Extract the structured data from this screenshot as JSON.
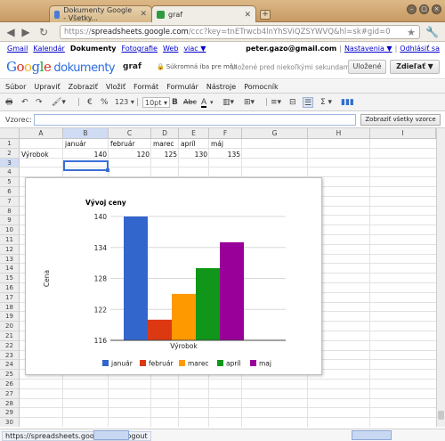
{
  "browser": {
    "tabs": [
      {
        "title": "Dokumenty Google - Všetky..."
      },
      {
        "title": "graf"
      }
    ],
    "new_tab": "+",
    "url": {
      "scheme": "https://",
      "domain": "spreadsheets.google.com",
      "path": "/ccc?key=tnETrwcb4lnYhSViQZSYWVQ&hl=sk#gid=0"
    }
  },
  "gbar": {
    "left": [
      "Gmail",
      "Kalendár",
      "Dokumenty",
      "Fotografie",
      "Web",
      "viac ▼"
    ],
    "current": "Dokumenty",
    "email": "peter.gazo@gmail.com",
    "settings": "Nastavenia ▼",
    "logout": "Odhlásiť sa"
  },
  "titlebar": {
    "logo_letters": [
      "G",
      "o",
      "o",
      "g",
      "l",
      "e"
    ],
    "logo_suffix": "dokumenty",
    "doc_name": "graf",
    "privacy": "Súkromná iba pre mňa",
    "save_status": "Uložené pred niekoľkými sekundami",
    "save_button": "Uložené",
    "share_button": "Zdieľať ▼"
  },
  "menu": [
    "Súbor",
    "Upraviť",
    "Zobraziť",
    "Vložiť",
    "Formát",
    "Formulár",
    "Nástroje",
    "Pomocník"
  ],
  "format_toolbar": {
    "currency": "€",
    "percent": "%",
    "number_format": "123 ▾",
    "font_size": "10pt ▾",
    "bold": "B",
    "strike": "Abc",
    "text_color": "A",
    "sum": "Σ ▾"
  },
  "formula_bar": {
    "label": "Vzorec:",
    "value": "",
    "show_all_button": "Zobraziť všetky vzorce"
  },
  "sheet": {
    "columns": [
      "A",
      "B",
      "C",
      "D",
      "E",
      "F",
      "G",
      "H",
      "I"
    ],
    "selected_column": "B",
    "rows": [
      "1",
      "2",
      "3",
      "4",
      "5",
      "6",
      "7",
      "8",
      "9",
      "10",
      "11",
      "12",
      "13",
      "14",
      "15",
      "16",
      "17",
      "18",
      "19",
      "20",
      "21",
      "22",
      "23",
      "24",
      "25",
      "26",
      "27",
      "28",
      "29",
      "30"
    ],
    "selected_row": "3",
    "row1": {
      "B": "január",
      "C": "február",
      "D": "marec",
      "E": "apríl",
      "F": "máj"
    },
    "row2": {
      "A": "Výrobok",
      "B": "140",
      "C": "120",
      "D": "125",
      "E": "130",
      "F": "135"
    }
  },
  "chart_data": {
    "type": "bar",
    "title": "Vývoj ceny",
    "xlabel": "Výrobok",
    "ylabel": "Cena",
    "categories": [
      "Výrobok"
    ],
    "series": [
      {
        "name": "január",
        "values": [
          140
        ],
        "color": "#3366cc"
      },
      {
        "name": "február",
        "values": [
          120
        ],
        "color": "#dc3912"
      },
      {
        "name": "marec",
        "values": [
          125
        ],
        "color": "#ff9900"
      },
      {
        "name": "apríl",
        "values": [
          130
        ],
        "color": "#109618"
      },
      {
        "name": "maj",
        "values": [
          135
        ],
        "color": "#990099"
      }
    ],
    "ylim": [
      116,
      140
    ],
    "yticks": [
      "116",
      "122",
      "128",
      "134",
      "140"
    ],
    "legend_position": "bottom",
    "grid": true
  },
  "status": {
    "url": "https://spreadsheets.google.com/logout"
  }
}
